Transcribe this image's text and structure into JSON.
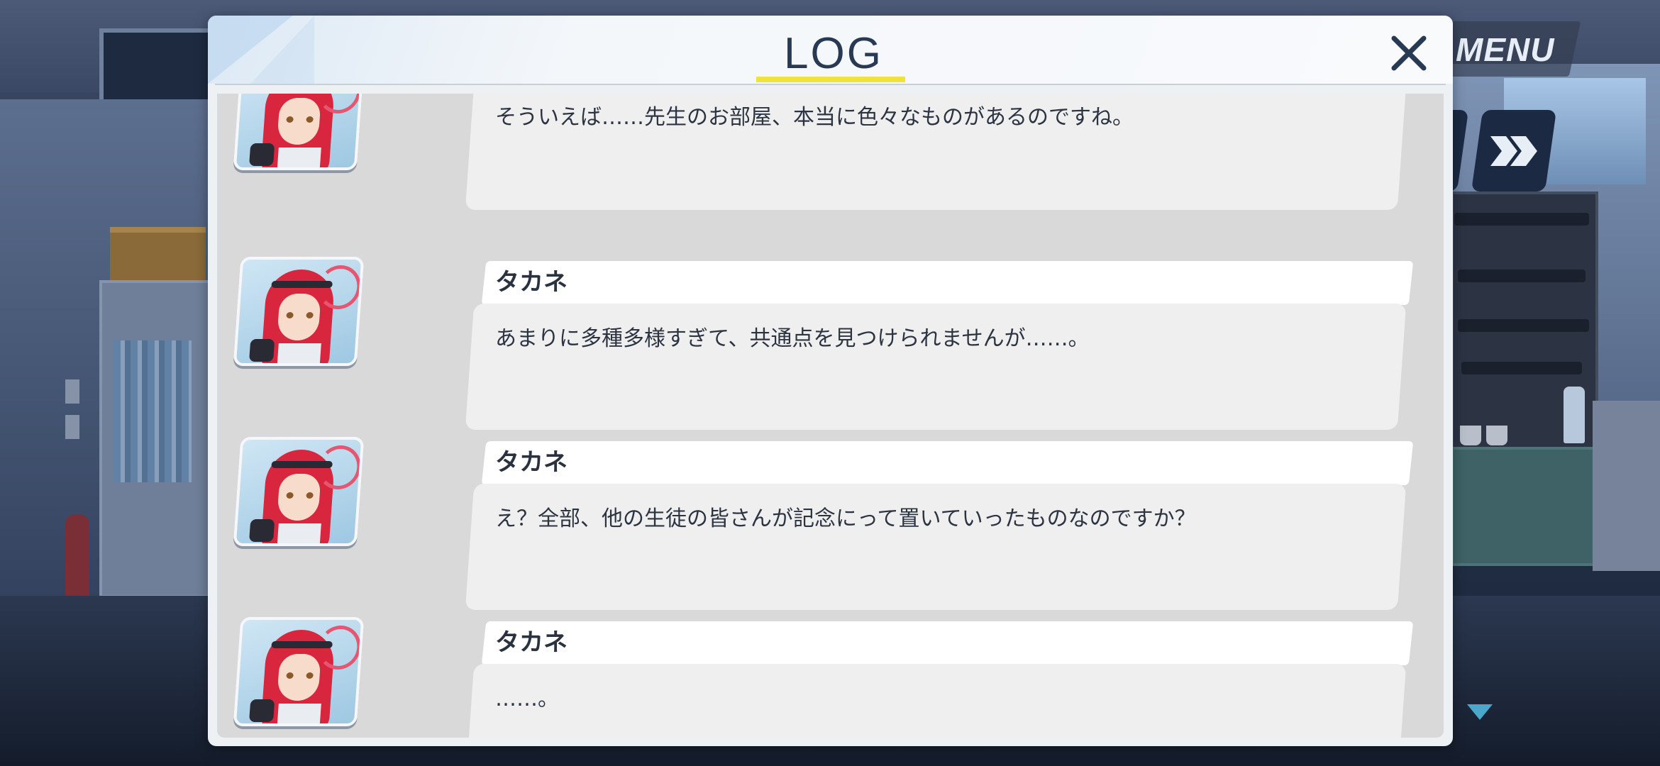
{
  "header": {
    "title": "LOG",
    "close_icon": "close-icon",
    "accent_color": "#f0e23a"
  },
  "hud": {
    "menu_label": "MENU",
    "skip_icon": "fast-forward-icon",
    "scroll_indicator_icon": "triangle-down-icon"
  },
  "log": {
    "entries": [
      {
        "speaker": "",
        "text": "そういえば……先生のお部屋、本当に色々なものがあるのですね。"
      },
      {
        "speaker": "タカネ",
        "text": "あまりに多種多様すぎて、共通点を見つけられませんが……。"
      },
      {
        "speaker": "タカネ",
        "text": "え？全部、他の生徒の皆さんが記念にって置いていったものなのですか？"
      },
      {
        "speaker": "タカネ",
        "text": "……。"
      }
    ]
  }
}
